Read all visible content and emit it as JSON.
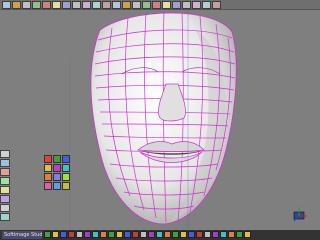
{
  "window": {
    "taskbar_label": "Softimage Studio"
  },
  "colors": {
    "background": "#7f7f7f",
    "mesh": "#d030d0",
    "surface_light": "#f2f2f2",
    "surface_dark": "#bfbfbf"
  },
  "toolbar": {
    "icons": [
      "select-icon",
      "move-icon",
      "rotate-icon",
      "scale-icon",
      "camera-icon",
      "light-icon",
      "grid-icon",
      "render-icon",
      "material-icon",
      "curve-icon",
      "patch-icon",
      "mesh-icon",
      "view-front-icon",
      "view-side-icon",
      "view-top-icon",
      "view-persp-icon",
      "zoom-icon",
      "pan-icon",
      "orbit-icon",
      "frame-icon",
      "undo-icon",
      "redo-icon"
    ]
  },
  "left_tools": {
    "icons": [
      "tool-1-icon",
      "tool-2-icon",
      "tool-3-icon",
      "tool-4-icon",
      "tool-5-icon",
      "tool-6-icon",
      "tool-7-icon",
      "tool-8-icon"
    ]
  },
  "palette": {
    "icons": [
      "palette-a-icon",
      "palette-b-icon",
      "palette-c-icon",
      "palette-d-icon",
      "palette-e-icon",
      "palette-f-icon",
      "palette-g-icon",
      "palette-h-icon",
      "palette-i-icon",
      "palette-j-icon",
      "palette-k-icon",
      "palette-l-icon"
    ]
  },
  "bottom_bar": {
    "icons": [
      "b1-icon",
      "b2-icon",
      "b3-icon",
      "b4-icon",
      "b5-icon",
      "b6-icon",
      "b7-icon",
      "b8-icon",
      "b9-icon",
      "b10-icon",
      "b11-icon",
      "b12-icon",
      "b13-icon",
      "b14-icon",
      "b15-icon",
      "b16-icon",
      "b17-icon",
      "b18-icon",
      "b19-icon",
      "b20-icon",
      "b21-icon",
      "b22-icon",
      "b23-icon",
      "b24-icon",
      "b25-icon",
      "b26-icon"
    ]
  }
}
